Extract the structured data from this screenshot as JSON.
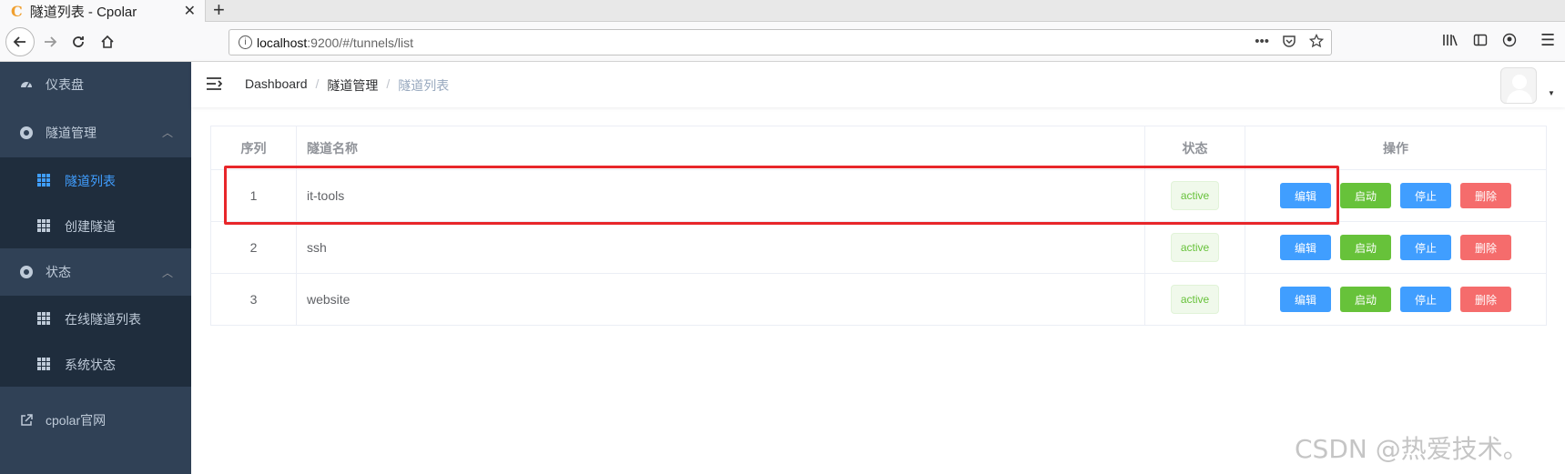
{
  "browser": {
    "tab_title": "隧道列表 - Cpolar",
    "tab_favicon": "C",
    "tab_close": "✕",
    "new_tab": "+",
    "url_host": "localhost",
    "url_rest": ":9200/#/tunnels/list"
  },
  "sidebar": {
    "items": [
      {
        "label": "仪表盘",
        "icon": "dashboard-icon"
      },
      {
        "label": "隧道管理",
        "icon": "circle-icon",
        "expanded": true
      },
      {
        "label": "隧道列表",
        "icon": "grid-icon",
        "active": true
      },
      {
        "label": "创建隧道",
        "icon": "grid-icon"
      },
      {
        "label": "状态",
        "icon": "circle-icon",
        "expanded": true
      },
      {
        "label": "在线隧道列表",
        "icon": "grid-icon"
      },
      {
        "label": "系统状态",
        "icon": "grid-icon"
      },
      {
        "label": "cpolar官网",
        "icon": "external-link-icon"
      }
    ]
  },
  "header": {
    "breadcrumb": [
      "Dashboard",
      "隧道管理",
      "隧道列表"
    ]
  },
  "table": {
    "columns": [
      "序列",
      "隧道名称",
      "状态",
      "操作"
    ],
    "rows": [
      {
        "index": "1",
        "name": "it-tools",
        "status": "active"
      },
      {
        "index": "2",
        "name": "ssh",
        "status": "active"
      },
      {
        "index": "3",
        "name": "website",
        "status": "active"
      }
    ],
    "actions": {
      "edit": "编辑",
      "start": "启动",
      "stop": "停止",
      "delete": "删除"
    }
  },
  "watermark": "CSDN @热爱技术。",
  "colors": {
    "sidebar_bg": "#304156",
    "submenu_bg": "#1f2d3d",
    "primary": "#409eff",
    "success": "#67c23a",
    "danger": "#f56c6c",
    "highlight_box": "#e8262a"
  }
}
